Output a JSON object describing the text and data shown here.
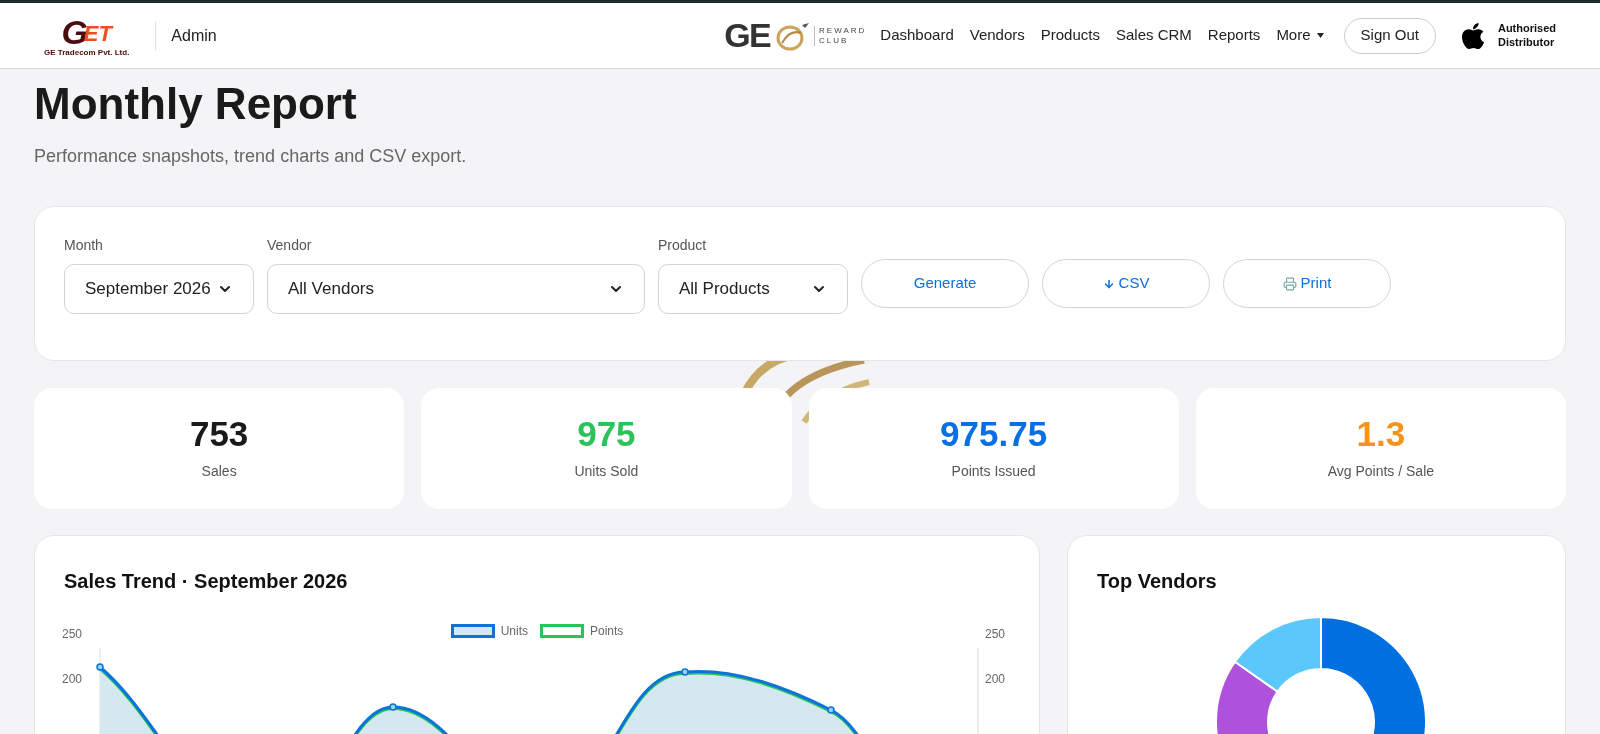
{
  "brand": {
    "mark_first": "G",
    "mark_rest": "ET",
    "company": "GE Tradecom Pvt. Ltd.",
    "section": "Admin"
  },
  "partner_logo": {
    "letters": "GE",
    "line1": "REWARD",
    "line2": "CLUB"
  },
  "nav": [
    {
      "label": "Dashboard",
      "kind": "link"
    },
    {
      "label": "Vendors",
      "kind": "link"
    },
    {
      "label": "Products",
      "kind": "link"
    },
    {
      "label": "Sales CRM",
      "kind": "link"
    },
    {
      "label": "Reports",
      "kind": "link"
    },
    {
      "label": "More",
      "kind": "menu"
    }
  ],
  "sign_out": "Sign Out",
  "distributor": {
    "line1": "Authorised",
    "line2": "Distributor"
  },
  "page": {
    "title": "Monthly Report",
    "subtitle": "Performance snapshots, trend charts and CSV export."
  },
  "filters": [
    {
      "label": "Month",
      "value": "September 2026",
      "kind": "short"
    },
    {
      "label": "Vendor",
      "value": "All Vendors",
      "kind": "wide"
    },
    {
      "label": "Product",
      "value": "All Products",
      "kind": "short"
    }
  ],
  "actions": [
    {
      "label": "Generate",
      "kind": "plain"
    },
    {
      "label": "CSV",
      "kind": "download"
    },
    {
      "label": "Print",
      "kind": "print"
    }
  ],
  "stats": [
    {
      "value": "753",
      "label": "Sales",
      "color": "#1a1a1a"
    },
    {
      "value": "975",
      "label": "Units Sold",
      "color": "#2cc35a"
    },
    {
      "value": "975.75",
      "label": "Points Issued",
      "color": "#0a6fe0"
    },
    {
      "value": "1.3",
      "label": "Avg Points / Sale",
      "color": "#f7931a"
    }
  ],
  "trend": {
    "title": "Sales Trend · September 2026",
    "legend": [
      {
        "label": "Units",
        "color": "#0a74da"
      },
      {
        "label": "Points",
        "color": "#2cc35a"
      }
    ],
    "left_ticks": [
      "250",
      "200"
    ],
    "right_ticks": [
      "250",
      "200"
    ]
  },
  "vendors": {
    "title": "Top Vendors"
  }
}
